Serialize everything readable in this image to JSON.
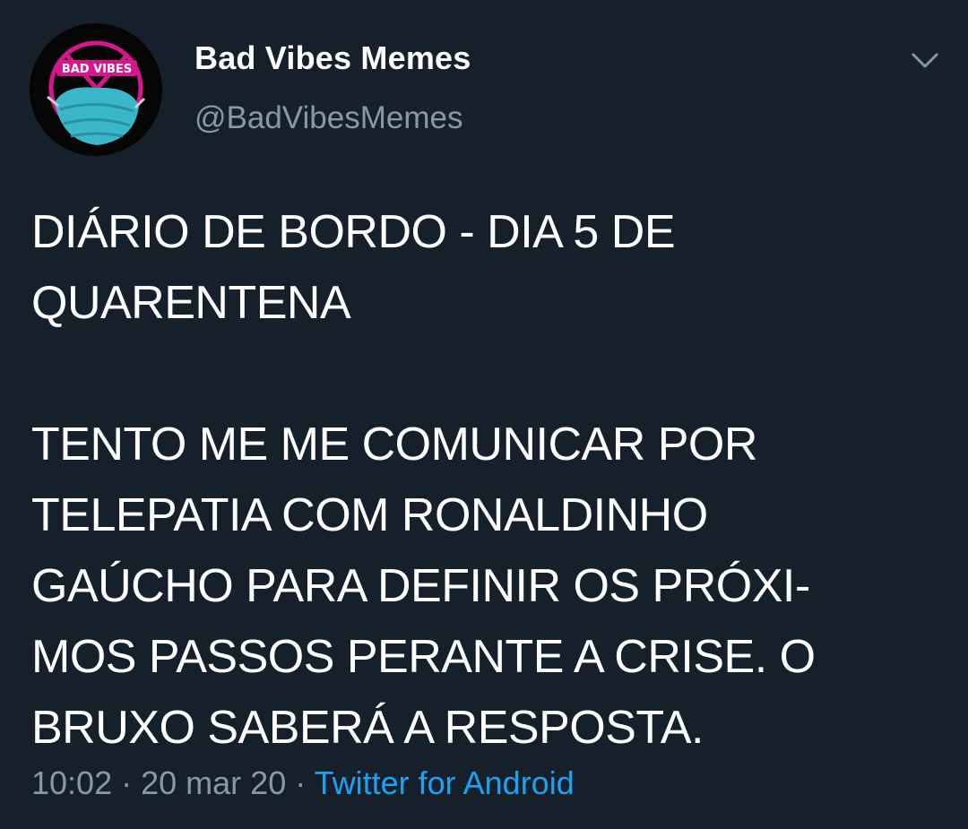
{
  "tweet": {
    "author": {
      "display_name": "Bad Vibes Memes",
      "handle": "@BadVibesMemes",
      "avatar_text": "BAD VIBES"
    },
    "body_lines": [
      "DIÁRIO DE BORDO - DIA 5 DE",
      "QUARENTENA",
      "",
      "TENTO ME ME COMUNICAR POR",
      "TELEPATIA COM RONALDINHO",
      "GAÚCHO PARA DEFINIR OS PRÓXI-",
      "MOS PASSOS PERANTE A CRISE. O",
      "BRUXO SABERÁ A RESPOSTA."
    ],
    "meta": {
      "time": "10:02",
      "separator": "·",
      "date": "20 mar 20",
      "source": "Twitter for Android"
    },
    "menu_icon": "chevron-down-icon"
  },
  "colors": {
    "background": "#15202b",
    "text": "#ffffff",
    "secondary_text": "#8899a6",
    "link": "#1da1f2"
  }
}
